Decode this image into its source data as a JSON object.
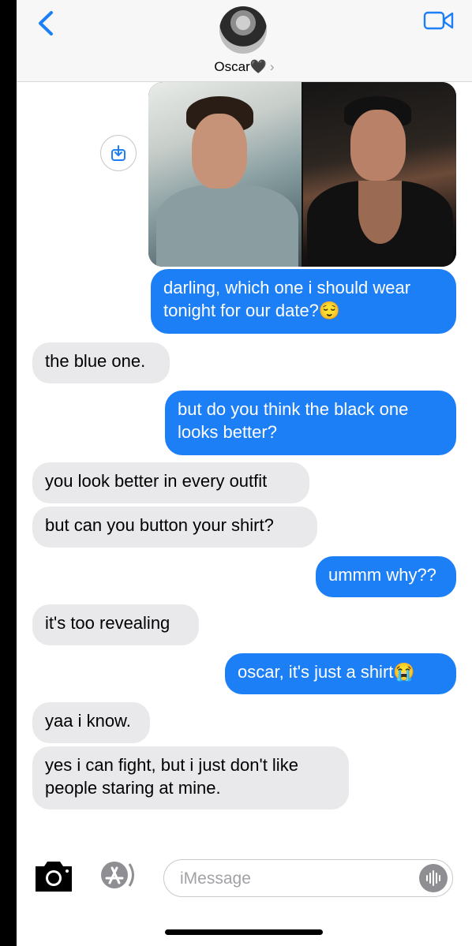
{
  "header": {
    "contact_name": "Oscar🖤",
    "chevron": "›",
    "back_icon": "chevron-left-icon",
    "video_icon": "video-camera-icon",
    "accent_color": "#1d7ff5"
  },
  "attachment": {
    "save_icon": "download-icon"
  },
  "messages": [
    {
      "from": "me",
      "text": "darling, which one i should wear\ntonight for our date?😌"
    },
    {
      "from": "them",
      "text": "the blue one."
    },
    {
      "from": "me",
      "text": "but do you think the black one\nlooks better?"
    },
    {
      "from": "them",
      "text": "you look better in every outfit"
    },
    {
      "from": "them",
      "text": "but can you button your shirt?"
    },
    {
      "from": "me",
      "text": "ummm why??"
    },
    {
      "from": "them",
      "text": "it's too revealing"
    },
    {
      "from": "me",
      "text": "oscar, it's just a shirt😭"
    },
    {
      "from": "them",
      "text": "yaa i know."
    },
    {
      "from": "them",
      "text": "yes i can fight, but i just don't like\npeople staring at mine."
    }
  ],
  "composer": {
    "placeholder": "iMessage",
    "camera_icon": "camera-icon",
    "apps_icon": "app-store-icon",
    "audio_icon": "audio-waveform-icon"
  },
  "colors": {
    "sent_bubble": "#1d7ff5",
    "received_bubble": "#e9e9eb"
  }
}
